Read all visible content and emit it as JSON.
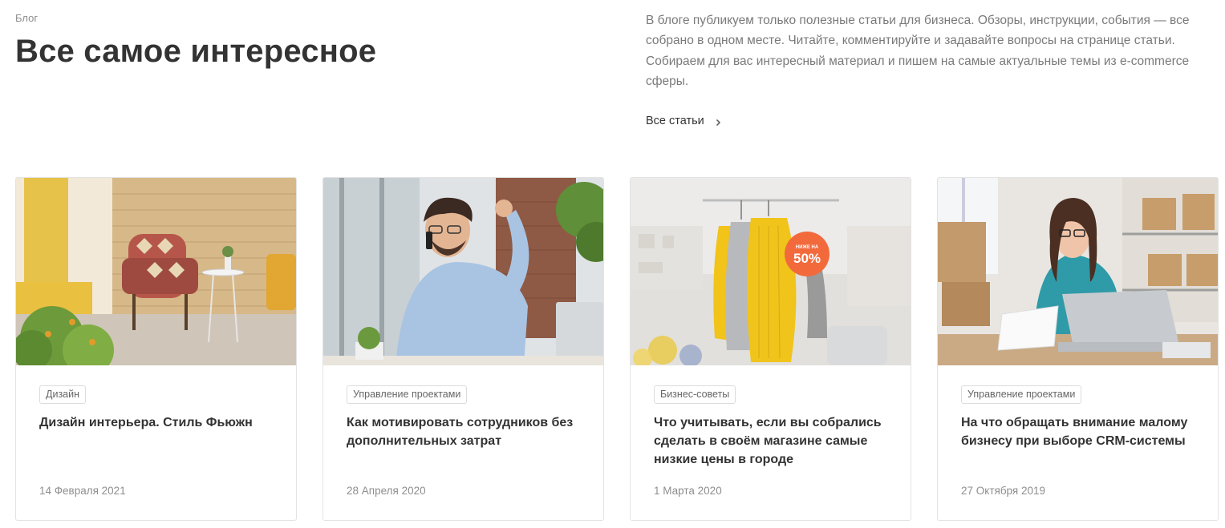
{
  "header": {
    "breadcrumb": "Блог",
    "title": "Все самое интересное",
    "intro": "В блоге публикуем только полезные статьи для бизнеса. Обзоры, инструкции, события — все собрано в одном месте. Читайте, комментируйте и задавайте вопросы на странице статьи. Собираем для вас интересный материал и пишем на самые актуальные темы из e-commerce сферы.",
    "all_articles_label": "Все статьи",
    "all_articles_icon": "chevron-right-icon"
  },
  "cards": [
    {
      "tag": "Дизайн",
      "title": "Дизайн интерьера. Стиль Фьюжн",
      "date": "14 Февраля 2021",
      "image": "interior-armchair-photo"
    },
    {
      "tag": "Управление проектами",
      "title": "Как мотивировать сотрудников без дополнительных затрат",
      "date": "28 Апреля 2020",
      "image": "happy-man-phone-photo"
    },
    {
      "tag": "Бизнес-советы",
      "title": "Что учитывать, если вы собрались сделать в своём магазине самые низкие цены в городе",
      "date": "1 Марта 2020",
      "image": "clothes-rack-sale-photo",
      "badge_small": "НИЖЕ НА",
      "badge_big": "50%"
    },
    {
      "tag": "Управление проектами",
      "title": "На что обращать внимание малому бизнесу при выборе CRM-системы",
      "date": "27 Октября 2019",
      "image": "woman-laptop-boxes-photo"
    }
  ],
  "colors": {
    "text": "#333333",
    "muted": "#7a7a7a",
    "border": "#e3e3e3",
    "badge": "#f26a3c"
  }
}
